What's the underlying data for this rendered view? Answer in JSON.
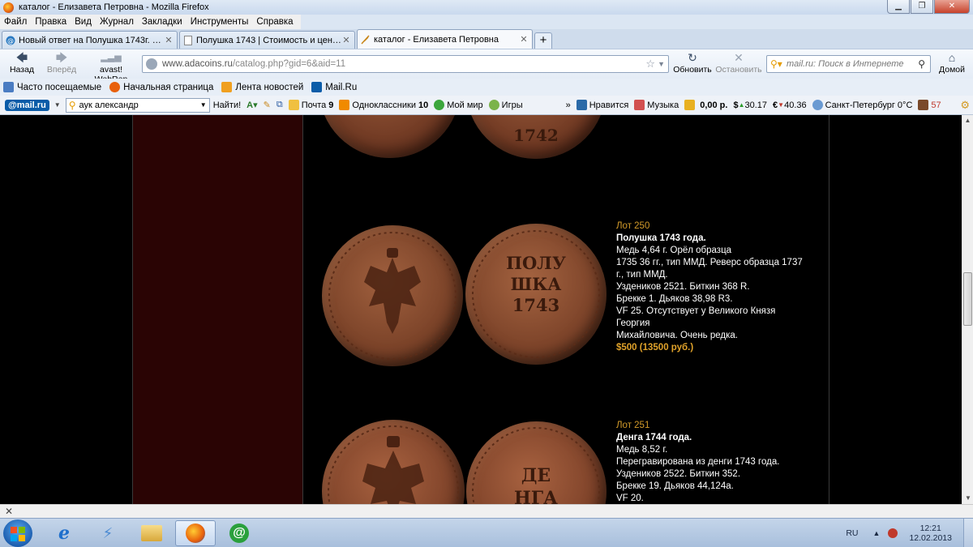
{
  "window": {
    "title": "каталог - Елизавета Петровна - Mozilla Firefox",
    "controls": [
      "minimize",
      "restore",
      "close"
    ]
  },
  "menu": [
    "Файл",
    "Правка",
    "Вид",
    "Журнал",
    "Закладки",
    "Инструменты",
    "Справка"
  ],
  "tabs": [
    {
      "label": "Новый ответ на Полушка 1743г. Раз...",
      "icon": "forum-icon",
      "active": false
    },
    {
      "label": "Полушка 1743 | Стоимость и цены ...",
      "icon": "page-icon",
      "active": false
    },
    {
      "label": "каталог - Елизавета Петровна",
      "icon": "quill-icon",
      "active": true
    }
  ],
  "newtab_label": "+",
  "nav": {
    "back": "Назад",
    "forward": "Вперёд",
    "avast": "avast! WebRep",
    "url_host": "www.adacoins.ru",
    "url_path": "/catalog.php?gid=6&aid=11",
    "refresh": "Обновить",
    "stop": "Остановить",
    "search_placeholder": "mail.ru: Поиск в Интернете",
    "home": "Домой"
  },
  "bookmarks": [
    {
      "label": "Часто посещаемые",
      "color": "#4a7cc2"
    },
    {
      "label": "Начальная страница",
      "color": "#e8600c"
    },
    {
      "label": "Лента новостей",
      "color": "#f0a020"
    },
    {
      "label": "Mail.Ru",
      "color": "#0b5ca8"
    }
  ],
  "mailbar": {
    "logo": "@mail.ru",
    "search_value": "аук александр",
    "find": "Найти!",
    "mail": "Почта",
    "mail_count": "9",
    "ok": "Одноклассники",
    "ok_count": "10",
    "myworld": "Мой мир",
    "games": "Игры",
    "more": "»",
    "likes": "Нравится",
    "music": "Музыка",
    "balance": "0,00 р.",
    "usd": "30.17",
    "eur": "40.36",
    "weather": "Санкт-Петербург 0°C",
    "karma": "57"
  },
  "lots": [
    {
      "number": "Лот 250",
      "title": "Полушка 1743 года.",
      "lines": [
        "Медь 4,64 г. Орёл образца",
        "1735 36 гг., тип ММД. Реверс образца 1737",
        "г., тип ММД.",
        "Уздеников 2521. Биткин 368 R.",
        "Бреккe 1. Дьяков 38,98 R3.",
        "VF 25. Отсутствует у Великого Князя",
        "Георгия",
        "Михайловича. Очень редка."
      ],
      "price": "$500 (13500 руб.)"
    },
    {
      "number": "Лот 251",
      "title": "Денга 1744 года.",
      "lines": [
        "Медь 8,52 г.",
        "Перегравирована из денги 1743 года.",
        "Уздеников 2522. Биткин 352.",
        "Бреккe 19. Дьяков 44,124а.",
        "VF 20."
      ],
      "price": ""
    }
  ],
  "coin_inscriptions": {
    "polushka_reverse": [
      "ПОЛУ",
      "ШКА",
      "1743"
    ],
    "denga_reverse": [
      "ДЕ",
      "НГА"
    ],
    "top_reverse": "1742"
  },
  "taskbar": {
    "apps": [
      "start-button",
      "ie-icon",
      "messenger-icon",
      "explorer-icon",
      "firefox-icon",
      "mail-agent-icon"
    ],
    "lang": "RU",
    "time": "12:21",
    "date": "12.02.2013"
  },
  "colors": {
    "page_bg": "#000000",
    "left_column": "#2a0404",
    "lot_number": "#d39b2a",
    "price": "#e0a22a",
    "coin_copper": "#8a4a2e"
  }
}
